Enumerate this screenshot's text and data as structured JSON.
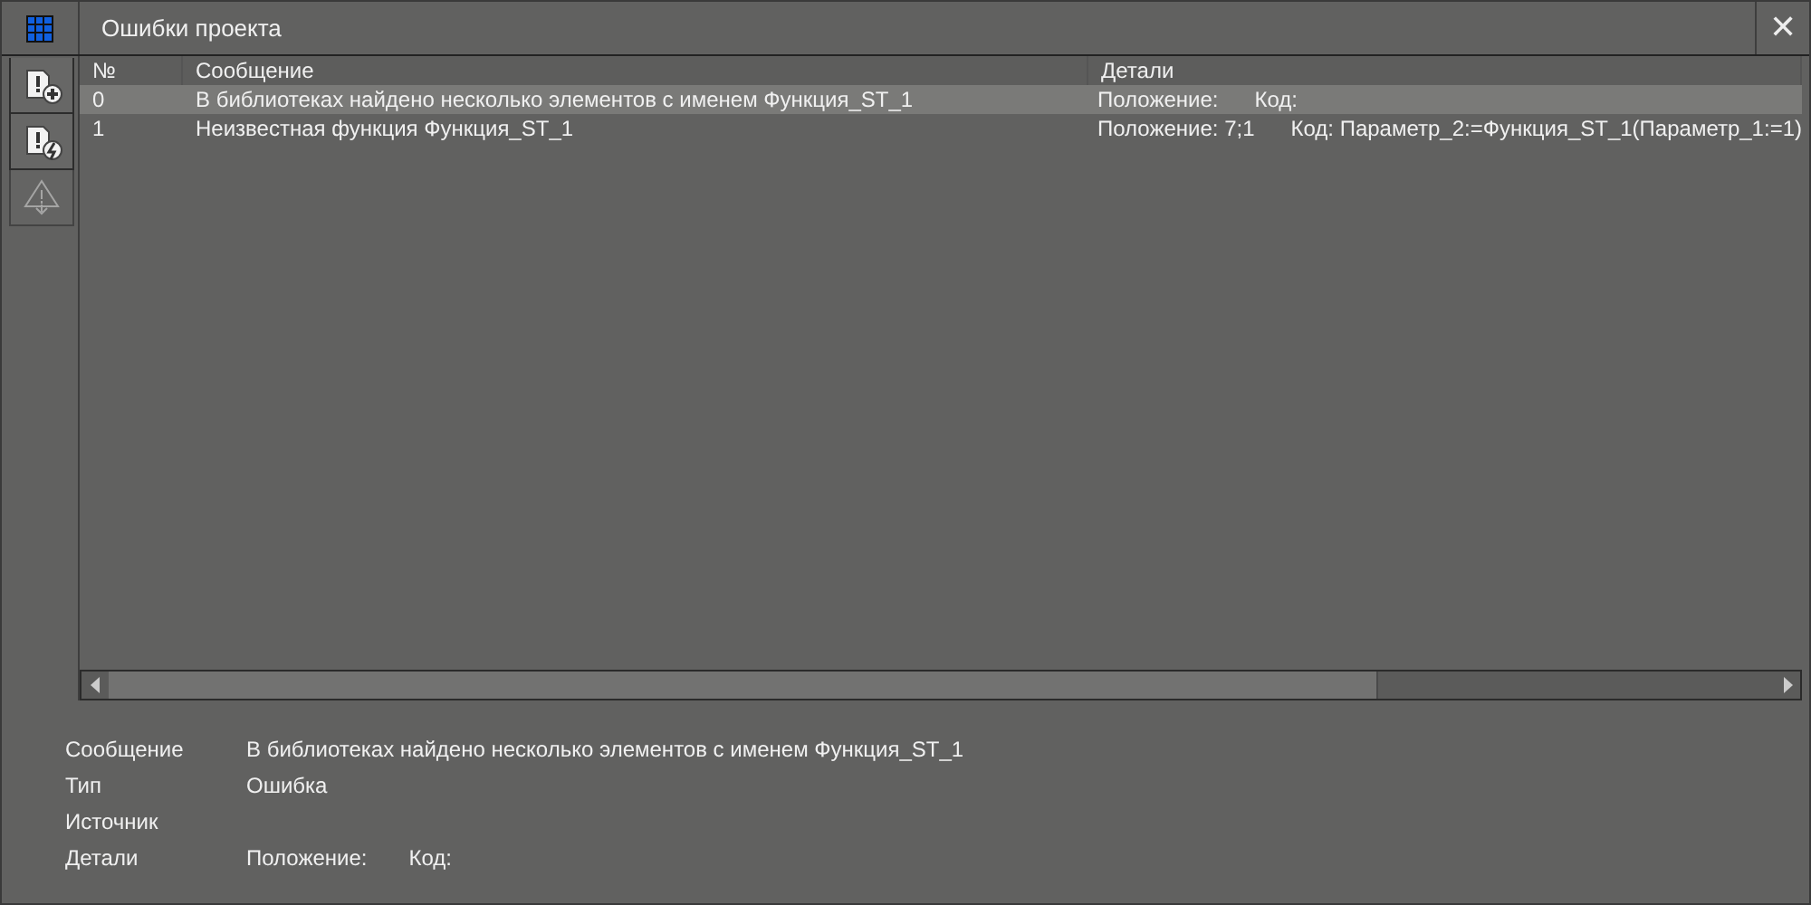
{
  "window": {
    "title": "Ошибки проекта",
    "close": "✕"
  },
  "toolbar": [
    {
      "kind": "add",
      "disabled": false
    },
    {
      "kind": "refresh",
      "disabled": false
    },
    {
      "kind": "warning",
      "disabled": true
    }
  ],
  "table": {
    "columns": [
      "№",
      "Сообщение",
      "Детали"
    ],
    "rows": [
      {
        "number": "0",
        "message": "В библиотеках найдено несколько элементов с именем Функция_ST_1",
        "position": "Положение:",
        "code": "Код:",
        "selected": true
      },
      {
        "number": "1",
        "message": "Неизвестная функция Функция_ST_1",
        "position": "Положение: 7;1",
        "code": "Код: Параметр_2:=Функция_ST_1(Параметр_1:=1)",
        "selected": false
      }
    ]
  },
  "details": [
    {
      "label": "Сообщение",
      "value": "В библиотеках найдено несколько элементов с именем Функция_ST_1"
    },
    {
      "label": "Тип",
      "value": "Ошибка"
    },
    {
      "label": "Источник"
    },
    {
      "label": "Детали",
      "position": "Положение:",
      "code": "Код:"
    }
  ]
}
